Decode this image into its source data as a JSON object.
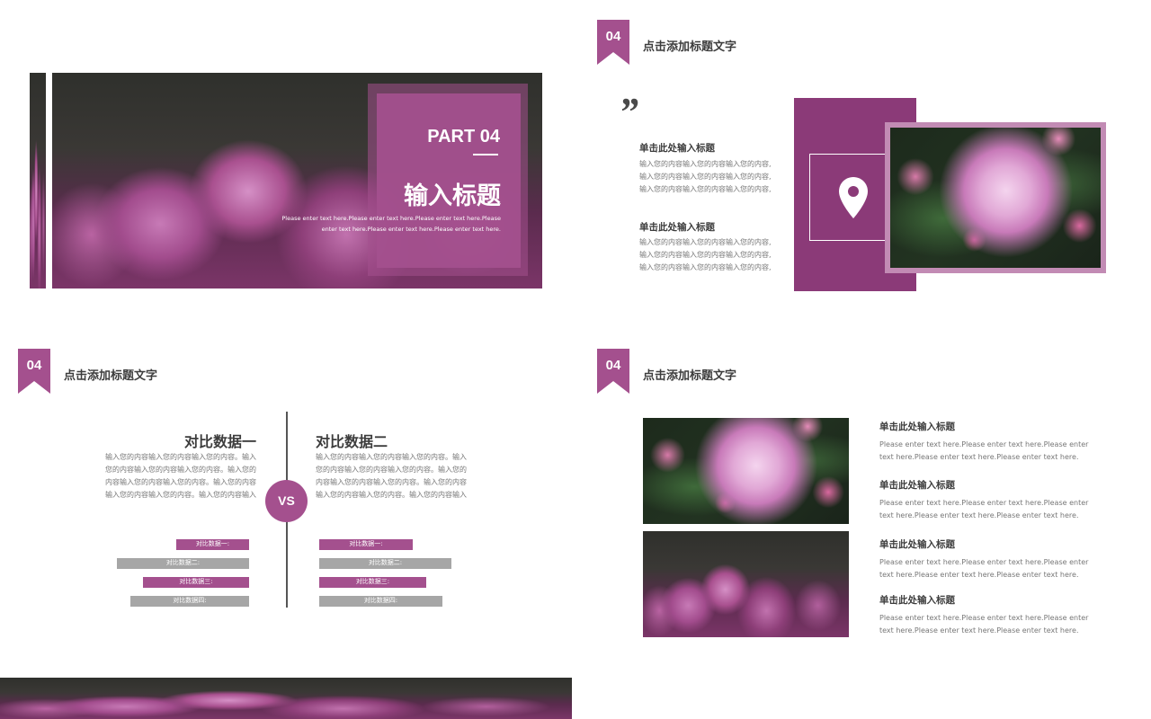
{
  "colors": {
    "accent": "#a4508e",
    "accent_dark": "#8b3a78",
    "accent_light": "#c28bb4",
    "gray": "#a6a6a6"
  },
  "slide1": {
    "part": "PART 04",
    "title": "输入标题",
    "desc_line1": "Please enter text here.Please enter text here.Please enter text here.Please",
    "desc_line2": "enter text here.Please enter text here.Please enter text here."
  },
  "slide2": {
    "tag": "04",
    "header": "点击添加标题文字",
    "quote_mark": "”",
    "items": [
      {
        "title": "单击此处输入标题",
        "lines": [
          "输入您的内容输入您的内容输入您的内容,",
          "输入您的内容输入您的内容输入您的内容,",
          "输入您的内容输入您的内容输入您的内容,"
        ]
      },
      {
        "title": "单击此处输入标题",
        "lines": [
          "输入您的内容输入您的内容输入您的内容,",
          "输入您的内容输入您的内容输入您的内容,",
          "输入您的内容输入您的内容输入您的内容,"
        ]
      }
    ],
    "icon": "location-pin-icon"
  },
  "slide3": {
    "tag": "04",
    "header": "点击添加标题文字",
    "left_title": "对比数据一",
    "right_title": "对比数据二",
    "vs": "VS",
    "left_lines": [
      "输入您的内容输入您的内容输入您的内容。输入",
      "您的内容输入您的内容输入您的内容。输入您的",
      "内容输入您的内容输入您的内容。输入您的内容",
      "输入您的内容输入您的内容。输入您的内容输入"
    ],
    "right_lines": [
      "输入您的内容输入您的内容输入您的内容。输入",
      "您的内容输入您的内容输入您的内容。输入您的",
      "内容输入您的内容输入您的内容。输入您的内容",
      "输入您的内容输入您的内容。输入您的内容输入"
    ],
    "left_bars": [
      {
        "label": "对比数据一:",
        "value": 0.55,
        "color": "#a4508e"
      },
      {
        "label": "对比数据二:",
        "value": 1.0,
        "color": "#a6a6a6"
      },
      {
        "label": "对比数据三:",
        "value": 0.8,
        "color": "#a4508e"
      },
      {
        "label": "对比数据四:",
        "value": 0.9,
        "color": "#a6a6a6"
      }
    ],
    "right_bars": [
      {
        "label": "对比数据一:",
        "value": 0.71,
        "color": "#a4508e"
      },
      {
        "label": "对比数据二:",
        "value": 1.0,
        "color": "#a6a6a6"
      },
      {
        "label": "对比数据三:",
        "value": 0.81,
        "color": "#a4508e"
      },
      {
        "label": "对比数据四:",
        "value": 0.93,
        "color": "#a6a6a6"
      }
    ]
  },
  "slide4": {
    "tag": "04",
    "header": "点击添加标题文字",
    "items": [
      {
        "title": "单击此处输入标题",
        "line1": "Please enter text here.Please enter text here.Please enter",
        "line2": "text here.Please enter text here.Please enter text here."
      },
      {
        "title": "单击此处输入标题",
        "line1": "Please enter text here.Please enter text here.Please enter",
        "line2": "text here.Please enter text here.Please enter text here."
      },
      {
        "title": "单击此处输入标题",
        "line1": "Please enter text here.Please enter text here.Please enter",
        "line2": "text here.Please enter text here.Please enter text here."
      },
      {
        "title": "单击此处输入标题",
        "line1": "Please enter text here.Please enter text here.Please enter",
        "line2": "text here.Please enter text here.Please enter text here."
      }
    ]
  }
}
